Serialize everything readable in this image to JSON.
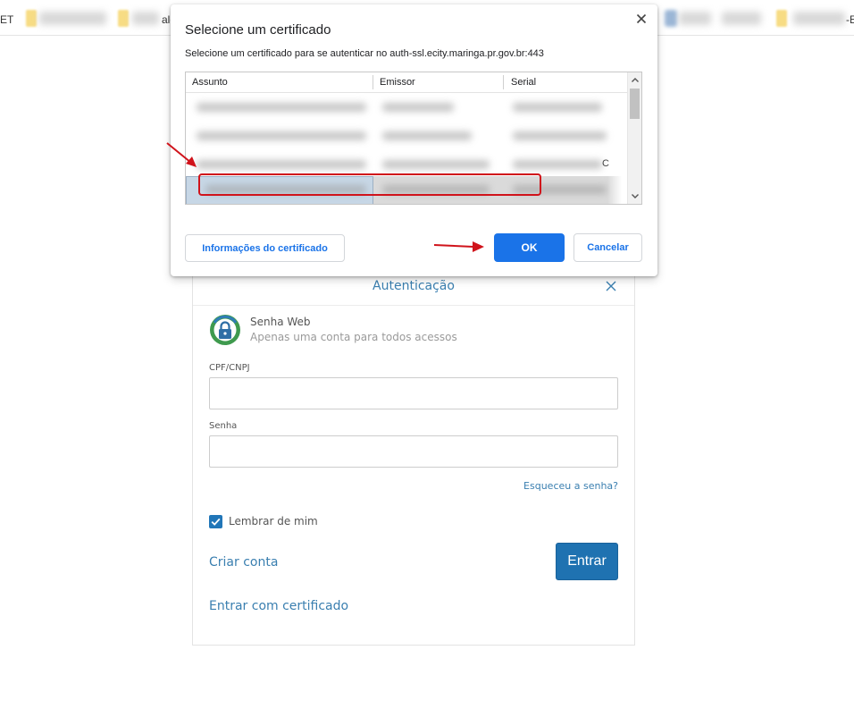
{
  "bookmarks": {
    "left_fragment": "ET",
    "item2_fragment": "ale",
    "right_fragment": "-E"
  },
  "dialog": {
    "title": "Selecione um certificado",
    "description": "Selecione um certificado para se autenticar no auth-ssl.ecity.maringa.pr.gov.br:443",
    "columns": [
      "Assunto",
      "Emissor",
      "Serial"
    ],
    "row_trailing_glyph": "C",
    "info_button_label": "Informações do certificado",
    "ok_label": "OK",
    "cancel_label": "Cancelar"
  },
  "auth": {
    "title": "Autenticação",
    "brand_name": "Senha Web",
    "brand_subtitle": "Apenas uma conta para todos acessos",
    "cpf_label": "CPF/CNPJ",
    "cpf_value": "",
    "password_label": "Senha",
    "password_value": "",
    "forgot_link": "Esqueceu a senha?",
    "remember_label": "Lembrar de mim",
    "remember_checked": true,
    "create_account": "Criar conta",
    "enter_button": "Entrar",
    "certificate_link": "Entrar com certificado"
  },
  "colors": {
    "dialog_accent": "#1a73e8",
    "auth_link": "#3a7fb0",
    "auth_button": "#1f72b1",
    "annotation_red": "#d0131b"
  },
  "icons": {
    "dialog_close": "close-icon",
    "auth_close": "close-icon",
    "brand": "lock-logo-icon",
    "remember": "checkmark-icon",
    "scroll_up": "chevron-up-icon",
    "scroll_down": "chevron-down-icon"
  }
}
